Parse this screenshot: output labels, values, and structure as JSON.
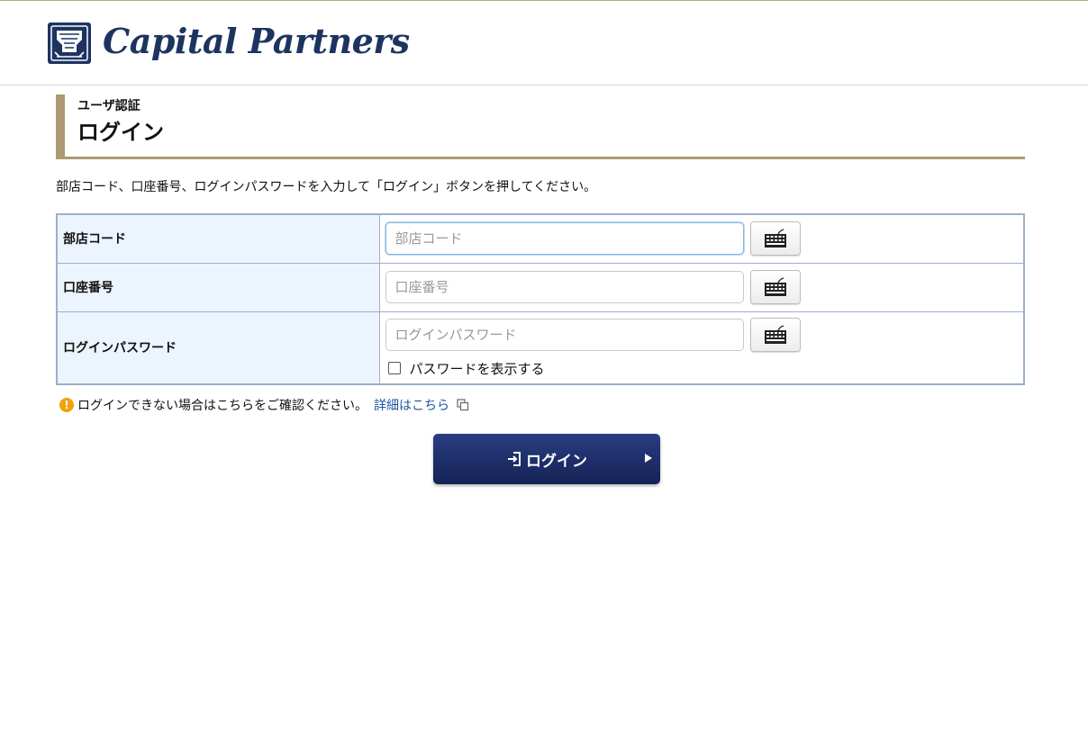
{
  "header": {
    "brand": "Capital Partners"
  },
  "page": {
    "subtitle": "ユーザ認証",
    "title": "ログイン",
    "instruction": "部店コード、口座番号、ログインパスワードを入力して「ログイン」ボタンを押してください。"
  },
  "form": {
    "branch_label": "部店コード",
    "branch_placeholder": "部店コード",
    "account_label": "口座番号",
    "account_placeholder": "口座番号",
    "password_label": "ログインパスワード",
    "password_placeholder": "ログインパスワード",
    "show_password_label": "パスワードを表示する"
  },
  "help": {
    "text": "ログインできない場合はこちらをご確認ください。",
    "link_text": "詳細はこちら"
  },
  "login_button": {
    "label": "ログイン"
  },
  "colors": {
    "brand_navy": "#1d3461",
    "accent_gold": "#ad9a72",
    "label_bg": "#ecf4fd",
    "link": "#1d55a4",
    "warn": "#f0a30a"
  },
  "icons": [
    "lion-logo-icon",
    "keyboard-icon",
    "warning-icon",
    "external-link-icon",
    "login-icon",
    "play-arrow-icon"
  ]
}
